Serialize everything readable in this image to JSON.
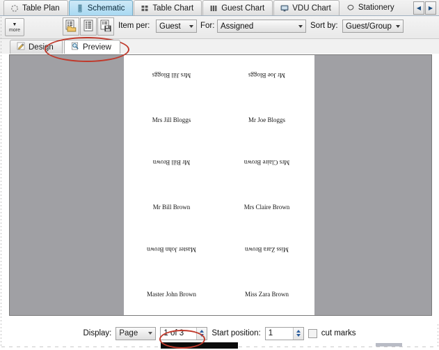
{
  "tabs": {
    "items": [
      {
        "label": "Table Plan",
        "icon": "circle-dashed-icon",
        "selected": false
      },
      {
        "label": "Schematic",
        "icon": "schematic-icon",
        "selected": true
      },
      {
        "label": "Table Chart",
        "icon": "table-grid-icon",
        "selected": false
      },
      {
        "label": "Guest Chart",
        "icon": "columns-icon",
        "selected": false
      },
      {
        "label": "VDU Chart",
        "icon": "monitor-icon",
        "selected": false
      },
      {
        "label": "Stationery",
        "icon": "tag-icon",
        "selected": false
      }
    ],
    "nav_prev": "◀",
    "nav_next": "▶"
  },
  "toolbar": {
    "more_button": {
      "label": "more",
      "caret": "▼"
    },
    "buttons": [
      {
        "name": "open-stationery-button",
        "icon": "open-folder-document-icon"
      },
      {
        "name": "new-stationery-button",
        "icon": "list-document-icon"
      },
      {
        "name": "save-stationery-button",
        "icon": "save-floppy-document-icon"
      }
    ],
    "item_per": {
      "label": "Item per:",
      "value": "Guest"
    },
    "for": {
      "label": "For:",
      "value": "Assigned"
    },
    "sort_by": {
      "label": "Sort by:",
      "value": "Guest/Group"
    }
  },
  "subtabs": {
    "design": {
      "label": "Design",
      "icon": "pencil-icon",
      "selected": false
    },
    "preview": {
      "label": "Preview",
      "icon": "magnifier-page-icon",
      "selected": true
    }
  },
  "preview": {
    "rows": [
      {
        "left": "Mrs Jill Bloggs",
        "right": "Mr Joe Bloggs"
      },
      {
        "left": "Mr Bill Brown",
        "right": "Mrs Claire Brown"
      },
      {
        "left": "Master John Brown",
        "right": "Miss Zara Brown"
      }
    ]
  },
  "statusbar": {
    "display_label": "Display:",
    "display_value": "Page",
    "page_value": "1 of 3",
    "start_position_label": "Start position:",
    "start_position_value": "1",
    "cut_marks_label": "cut marks",
    "cut_marks_checked": false
  },
  "colors": {
    "accent_tab": "#b9e0f4",
    "annotation": "#c0392b",
    "canvas_gray": "#a0a0a4"
  }
}
